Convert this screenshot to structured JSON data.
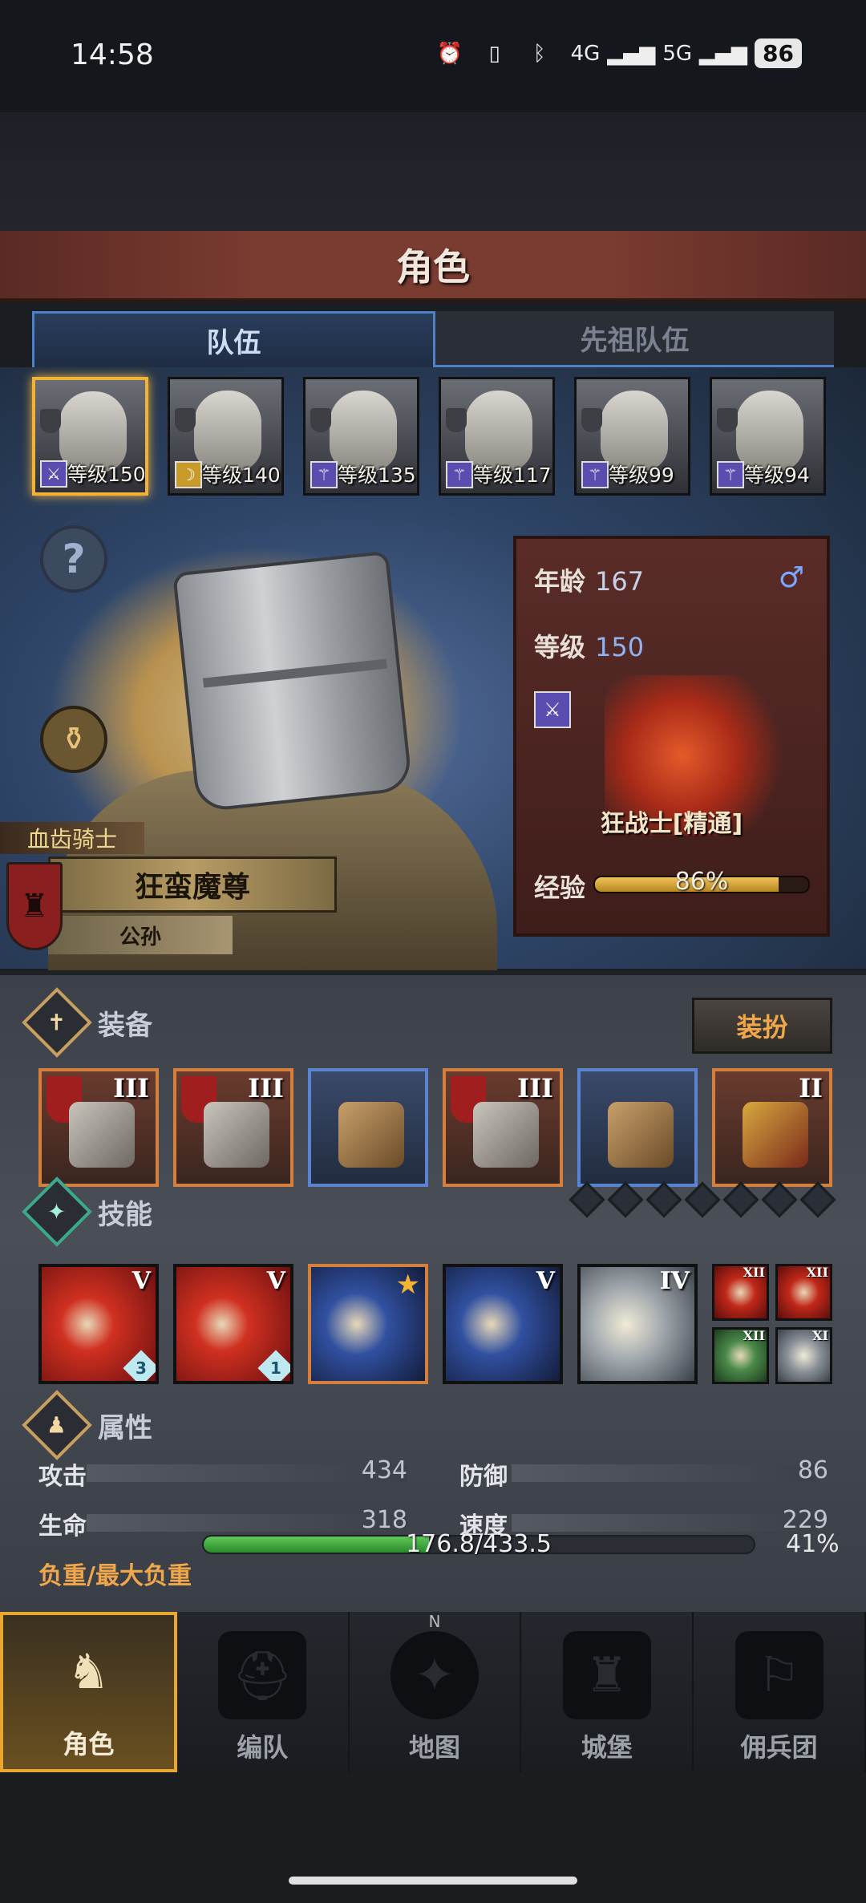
{
  "status_bar": {
    "time": "14:58",
    "signal_4g": "4G",
    "signal_5g": "5G",
    "battery": "86"
  },
  "title": "角色",
  "tabs": [
    {
      "label": "队伍",
      "active": true
    },
    {
      "label": "先祖队伍",
      "active": false
    }
  ],
  "roster": [
    {
      "level": "等级150",
      "selected": true
    },
    {
      "level": "等级140",
      "selected": false
    },
    {
      "level": "等级135",
      "selected": false
    },
    {
      "level": "等级117",
      "selected": false
    },
    {
      "level": "等级99",
      "selected": false
    },
    {
      "level": "等级94",
      "selected": false
    }
  ],
  "hero": {
    "faction": "血齿骑士",
    "name": "狂蛮魔尊",
    "family": "公孙"
  },
  "info": {
    "age_label": "年龄",
    "age": "167",
    "gender_symbol": "♂",
    "level_label": "等级",
    "level": "150",
    "class_name": "狂战士[精通]",
    "exp_label": "经验",
    "exp_text": "86%",
    "exp_fraction": 0.86
  },
  "equipment": {
    "title": "装备",
    "dress_button": "装扮",
    "slots": [
      {
        "tier": "III",
        "style": "orange",
        "emblem": true
      },
      {
        "tier": "III",
        "style": "orange",
        "emblem": true
      },
      {
        "tier": "",
        "style": "blue",
        "emblem": false
      },
      {
        "tier": "III",
        "style": "orange",
        "emblem": true
      },
      {
        "tier": "",
        "style": "blue",
        "emblem": false
      },
      {
        "tier": "II",
        "style": "orange",
        "emblem": false
      }
    ]
  },
  "skills": {
    "title": "技能",
    "slots": [
      {
        "tier": "V",
        "gem": "3",
        "style": "red"
      },
      {
        "tier": "V",
        "gem": "1",
        "style": "red"
      },
      {
        "tier": "",
        "gem": "",
        "style": "blue",
        "star": true
      },
      {
        "tier": "V",
        "gem": "",
        "style": "blue2"
      },
      {
        "tier": "IV",
        "gem": "",
        "style": "gray"
      }
    ],
    "small": [
      {
        "tier": "XII",
        "style": "red"
      },
      {
        "tier": "XII",
        "style": "red"
      },
      {
        "tier": "XII",
        "style": "green"
      },
      {
        "tier": "XI",
        "style": "gray"
      }
    ]
  },
  "attributes": {
    "title": "属性",
    "attack_label": "攻击",
    "attack": "434",
    "defense_label": "防御",
    "defense": "86",
    "hp_label": "生命",
    "hp": "318",
    "speed_label": "速度",
    "speed": "229",
    "load_label": "负重/最大负重",
    "load_text": "176.8/433.5",
    "load_pct": "41%",
    "load_fraction": 0.41
  },
  "nav": [
    {
      "label": "角色",
      "icon": "knight-icon",
      "active": true
    },
    {
      "label": "编队",
      "icon": "helmet-icon",
      "active": false
    },
    {
      "label": "地图",
      "icon": "compass-map-icon",
      "active": false,
      "compass": "N"
    },
    {
      "label": "城堡",
      "icon": "castle-icon",
      "active": false
    },
    {
      "label": "佣兵团",
      "icon": "mercenary-icon",
      "active": false
    }
  ]
}
